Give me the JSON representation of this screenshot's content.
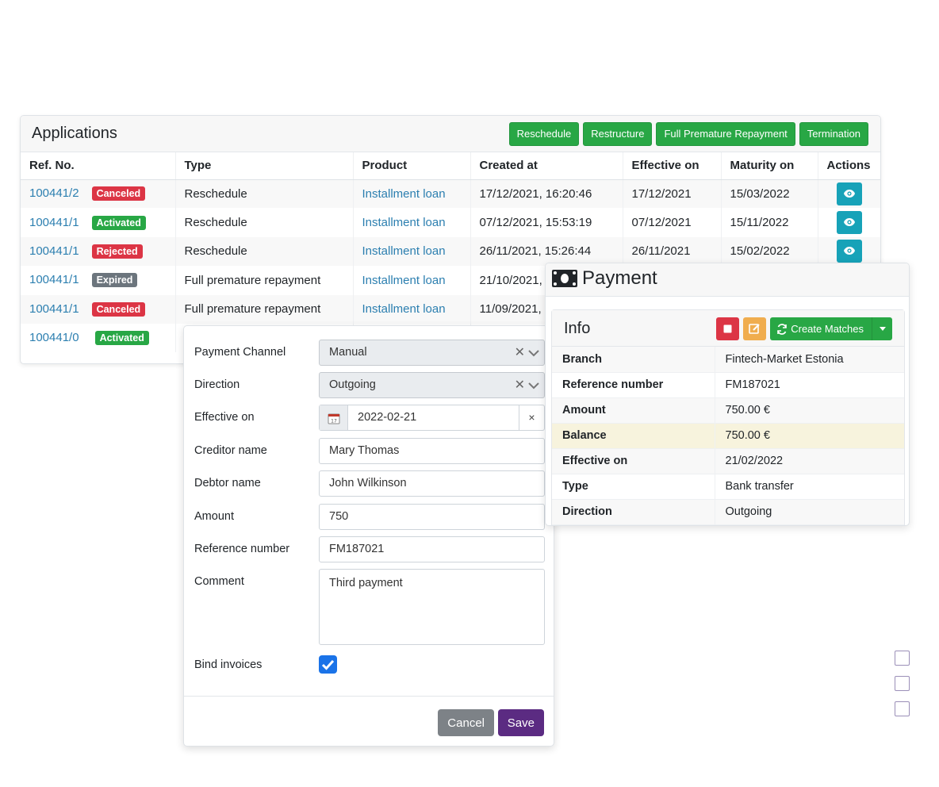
{
  "applications": {
    "title": "Applications",
    "buttons": [
      "Reschedule",
      "Restructure",
      "Full Premature Repayment",
      "Termination"
    ],
    "columns": [
      "Ref. No.",
      "Type",
      "Product",
      "Created at",
      "Effective on",
      "Maturity on",
      "Actions"
    ],
    "rows": [
      {
        "ref": "100441/2",
        "status": "Canceled",
        "status_color": "#dc3545",
        "type": "Reschedule",
        "product": "Installment loan",
        "created": "17/12/2021, 16:20:46",
        "effective": "17/12/2021",
        "maturity": "15/03/2022",
        "action_icon": "eye-icon"
      },
      {
        "ref": "100441/1",
        "status": "Activated",
        "status_color": "#28a745",
        "type": "Reschedule",
        "product": "Installment loan",
        "created": "07/12/2021, 15:53:19",
        "effective": "07/12/2021",
        "maturity": "15/11/2022",
        "action_icon": "eye-icon"
      },
      {
        "ref": "100441/1",
        "status": "Rejected",
        "status_color": "#dc3545",
        "type": "Reschedule",
        "product": "Installment loan",
        "created": "26/11/2021, 15:26:44",
        "effective": "26/11/2021",
        "maturity": "15/02/2022",
        "action_icon": "eye-icon"
      },
      {
        "ref": "100441/1",
        "status": "Expired",
        "status_color": "#6c757d",
        "type": "Full premature repayment",
        "product": "Installment loan",
        "created": "21/10/2021,",
        "effective": "",
        "maturity": "",
        "action_icon": ""
      },
      {
        "ref": "100441/1",
        "status": "Canceled",
        "status_color": "#dc3545",
        "type": "Full premature repayment",
        "product": "Installment loan",
        "created": "11/09/2021,",
        "effective": "",
        "maturity": "",
        "action_icon": ""
      },
      {
        "ref": "100441/0",
        "status": "Activated",
        "status_color": "#28a745",
        "type": "",
        "product": "",
        "created": "",
        "effective": "",
        "maturity": "",
        "action_icon": ""
      }
    ]
  },
  "form": {
    "payment_channel": {
      "label": "Payment Channel",
      "value": "Manual"
    },
    "direction": {
      "label": "Direction",
      "value": "Outgoing"
    },
    "effective_on": {
      "label": "Effective on",
      "value": "2022-02-21",
      "clear": "×"
    },
    "creditor_name": {
      "label": "Creditor name",
      "value": "Mary Thomas"
    },
    "debtor_name": {
      "label": "Debtor name",
      "value": "John Wilkinson"
    },
    "amount": {
      "label": "Amount",
      "value": "750"
    },
    "reference_number": {
      "label": "Reference number",
      "value": "FM187021"
    },
    "comment": {
      "label": "Comment",
      "value": "Third payment"
    },
    "bind_invoices": {
      "label": "Bind invoices",
      "checked": true
    },
    "cancel_label": "Cancel",
    "save_label": "Save"
  },
  "payment": {
    "title": "Payment",
    "info_title": "Info",
    "create_matches_label": "Create Matches",
    "rows": [
      {
        "key": "Branch",
        "value": "Fintech-Market Estonia"
      },
      {
        "key": "Reference number",
        "value": "FM187021"
      },
      {
        "key": "Amount",
        "value": "750.00 €"
      },
      {
        "key": "Balance",
        "value": "750.00 €"
      },
      {
        "key": "Effective on",
        "value": "21/02/2022"
      },
      {
        "key": "Type",
        "value": "Bank transfer"
      },
      {
        "key": "Direction",
        "value": "Outgoing"
      }
    ]
  },
  "colors": {
    "green": "#28a745",
    "red": "#dc3545",
    "teal": "#17a2b8",
    "link": "#2c7fb0",
    "save": "#5b2b82",
    "balance_highlight": "#f7f3dd"
  }
}
